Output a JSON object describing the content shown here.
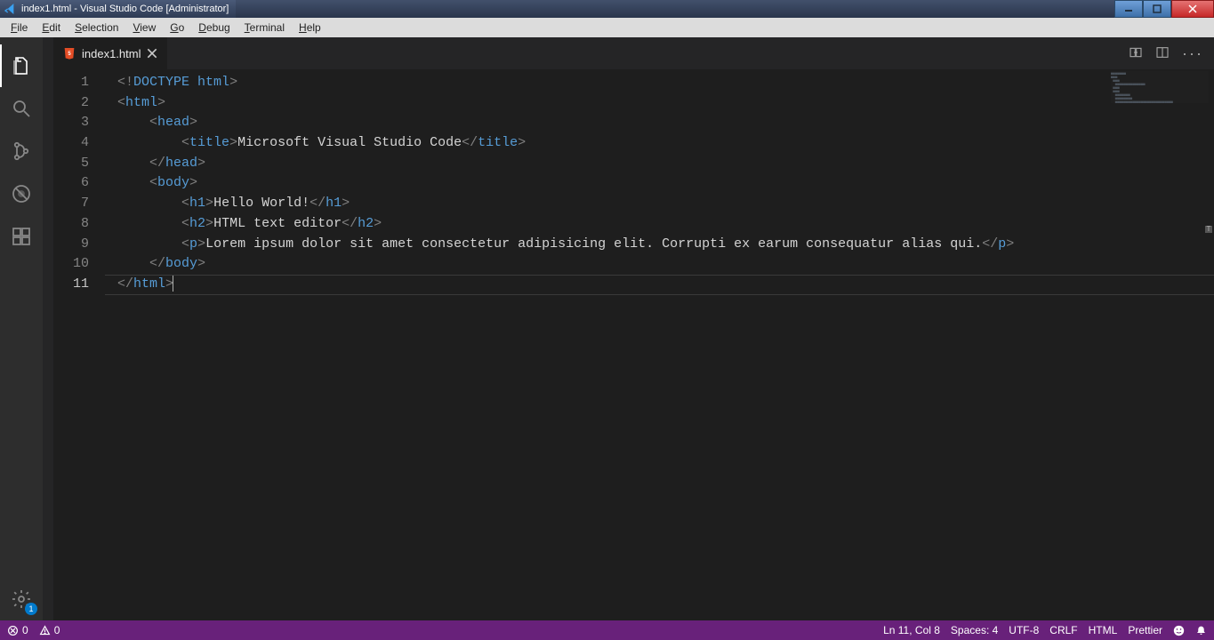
{
  "window": {
    "title": "index1.html - Visual Studio Code [Administrator]"
  },
  "menu": {
    "items": [
      "File",
      "Edit",
      "Selection",
      "View",
      "Go",
      "Debug",
      "Terminal",
      "Help"
    ]
  },
  "activity": {
    "settings_badge": "1"
  },
  "tab": {
    "filename": "index1.html"
  },
  "code": {
    "lines": [
      {
        "n": 1,
        "indent": 0,
        "tokens": [
          [
            "br",
            "<"
          ],
          [
            "excl",
            "!"
          ],
          [
            "doc",
            "DOCTYPE "
          ],
          [
            "kw",
            "html"
          ],
          [
            "br",
            ">"
          ]
        ]
      },
      {
        "n": 2,
        "indent": 0,
        "tokens": [
          [
            "br",
            "<"
          ],
          [
            "kw",
            "html"
          ],
          [
            "br",
            ">"
          ]
        ]
      },
      {
        "n": 3,
        "indent": 1,
        "tokens": [
          [
            "br",
            "<"
          ],
          [
            "kw",
            "head"
          ],
          [
            "br",
            ">"
          ]
        ]
      },
      {
        "n": 4,
        "indent": 2,
        "tokens": [
          [
            "br",
            "<"
          ],
          [
            "kw",
            "title"
          ],
          [
            "br",
            ">"
          ],
          [
            "txt",
            "Microsoft Visual Studio Code"
          ],
          [
            "br",
            "</"
          ],
          [
            "kw",
            "title"
          ],
          [
            "br",
            ">"
          ]
        ]
      },
      {
        "n": 5,
        "indent": 1,
        "tokens": [
          [
            "br",
            "</"
          ],
          [
            "kw",
            "head"
          ],
          [
            "br",
            ">"
          ]
        ]
      },
      {
        "n": 6,
        "indent": 1,
        "tokens": [
          [
            "br",
            "<"
          ],
          [
            "kw",
            "body"
          ],
          [
            "br",
            ">"
          ]
        ]
      },
      {
        "n": 7,
        "indent": 2,
        "tokens": [
          [
            "br",
            "<"
          ],
          [
            "kw",
            "h1"
          ],
          [
            "br",
            ">"
          ],
          [
            "txt",
            "Hello World!"
          ],
          [
            "br",
            "</"
          ],
          [
            "kw",
            "h1"
          ],
          [
            "br",
            ">"
          ]
        ]
      },
      {
        "n": 8,
        "indent": 2,
        "tokens": [
          [
            "br",
            "<"
          ],
          [
            "kw",
            "h2"
          ],
          [
            "br",
            ">"
          ],
          [
            "txt",
            "HTML text editor"
          ],
          [
            "br",
            "</"
          ],
          [
            "kw",
            "h2"
          ],
          [
            "br",
            ">"
          ]
        ]
      },
      {
        "n": 9,
        "indent": 2,
        "tokens": [
          [
            "br",
            "<"
          ],
          [
            "kw",
            "p"
          ],
          [
            "br",
            ">"
          ],
          [
            "txt",
            "Lorem ipsum dolor sit amet consectetur adipisicing elit. Corrupti ex earum consequatur alias qui."
          ],
          [
            "br",
            "</"
          ],
          [
            "kw",
            "p"
          ],
          [
            "br",
            ">"
          ]
        ]
      },
      {
        "n": 10,
        "indent": 1,
        "tokens": [
          [
            "br",
            "</"
          ],
          [
            "kw",
            "body"
          ],
          [
            "br",
            ">"
          ]
        ]
      },
      {
        "n": 11,
        "indent": 0,
        "current": true,
        "cursor": true,
        "tokens": [
          [
            "br",
            "</"
          ],
          [
            "kw",
            "html"
          ],
          [
            "br",
            ">"
          ]
        ]
      }
    ]
  },
  "status": {
    "errors": "0",
    "warnings": "0",
    "cursor": "Ln 11, Col 8",
    "spaces": "Spaces: 4",
    "encoding": "UTF-8",
    "eol": "CRLF",
    "language": "HTML",
    "formatter": "Prettier"
  }
}
